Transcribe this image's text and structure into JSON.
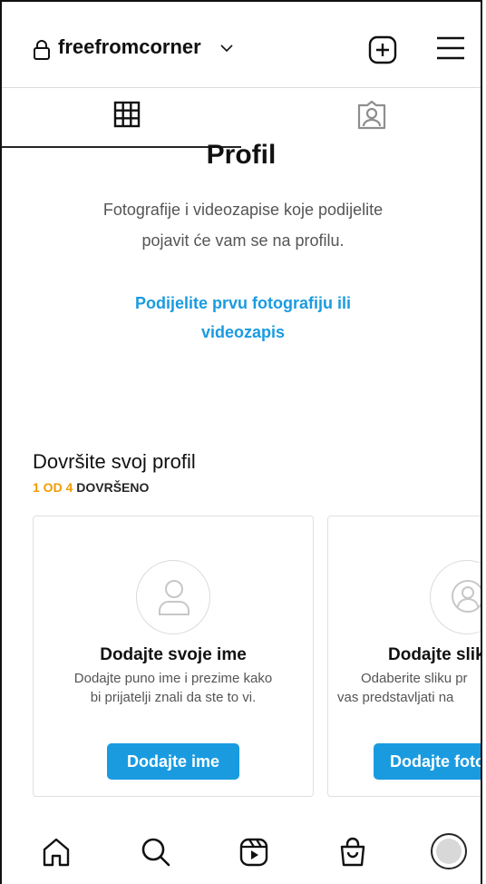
{
  "header": {
    "username": "freefromcorner",
    "icons": [
      "lock-icon",
      "chevron-down-icon",
      "plus-square-icon",
      "menu-icon"
    ]
  },
  "tabs": [
    {
      "icon": "grid-icon",
      "active": true
    },
    {
      "icon": "tagged-icon",
      "active": false
    }
  ],
  "empty_state": {
    "title": "Profil",
    "text": "Fotografije i videozapise koje podijelite pojavit će vam se na profilu.",
    "link": "Podijelite prvu fotografiju ili videozapis"
  },
  "complete_profile": {
    "title": "Dovršite svoj profil",
    "progress_done": "1 OD 4",
    "progress_label": "DOVRŠENO",
    "cards": [
      {
        "icon": "user-icon",
        "title": "Dodajte svoje ime",
        "desc_line1": "Dodajte puno ime i prezime kako",
        "desc_line2": "bi prijatelji znali da ste to vi.",
        "button": "Dodajte ime"
      },
      {
        "icon": "profile-photo-icon",
        "title": "Dodajte sliku",
        "desc_line1": "Odaberite sliku pr",
        "desc_line2": "vas predstavljati na",
        "button": "Dodajte foto"
      }
    ]
  },
  "bottom_nav": [
    "home-icon",
    "search-icon",
    "reels-icon",
    "shop-icon",
    "profile-avatar"
  ],
  "colors": {
    "accent": "#1a9be0",
    "progress": "#f19c00"
  }
}
